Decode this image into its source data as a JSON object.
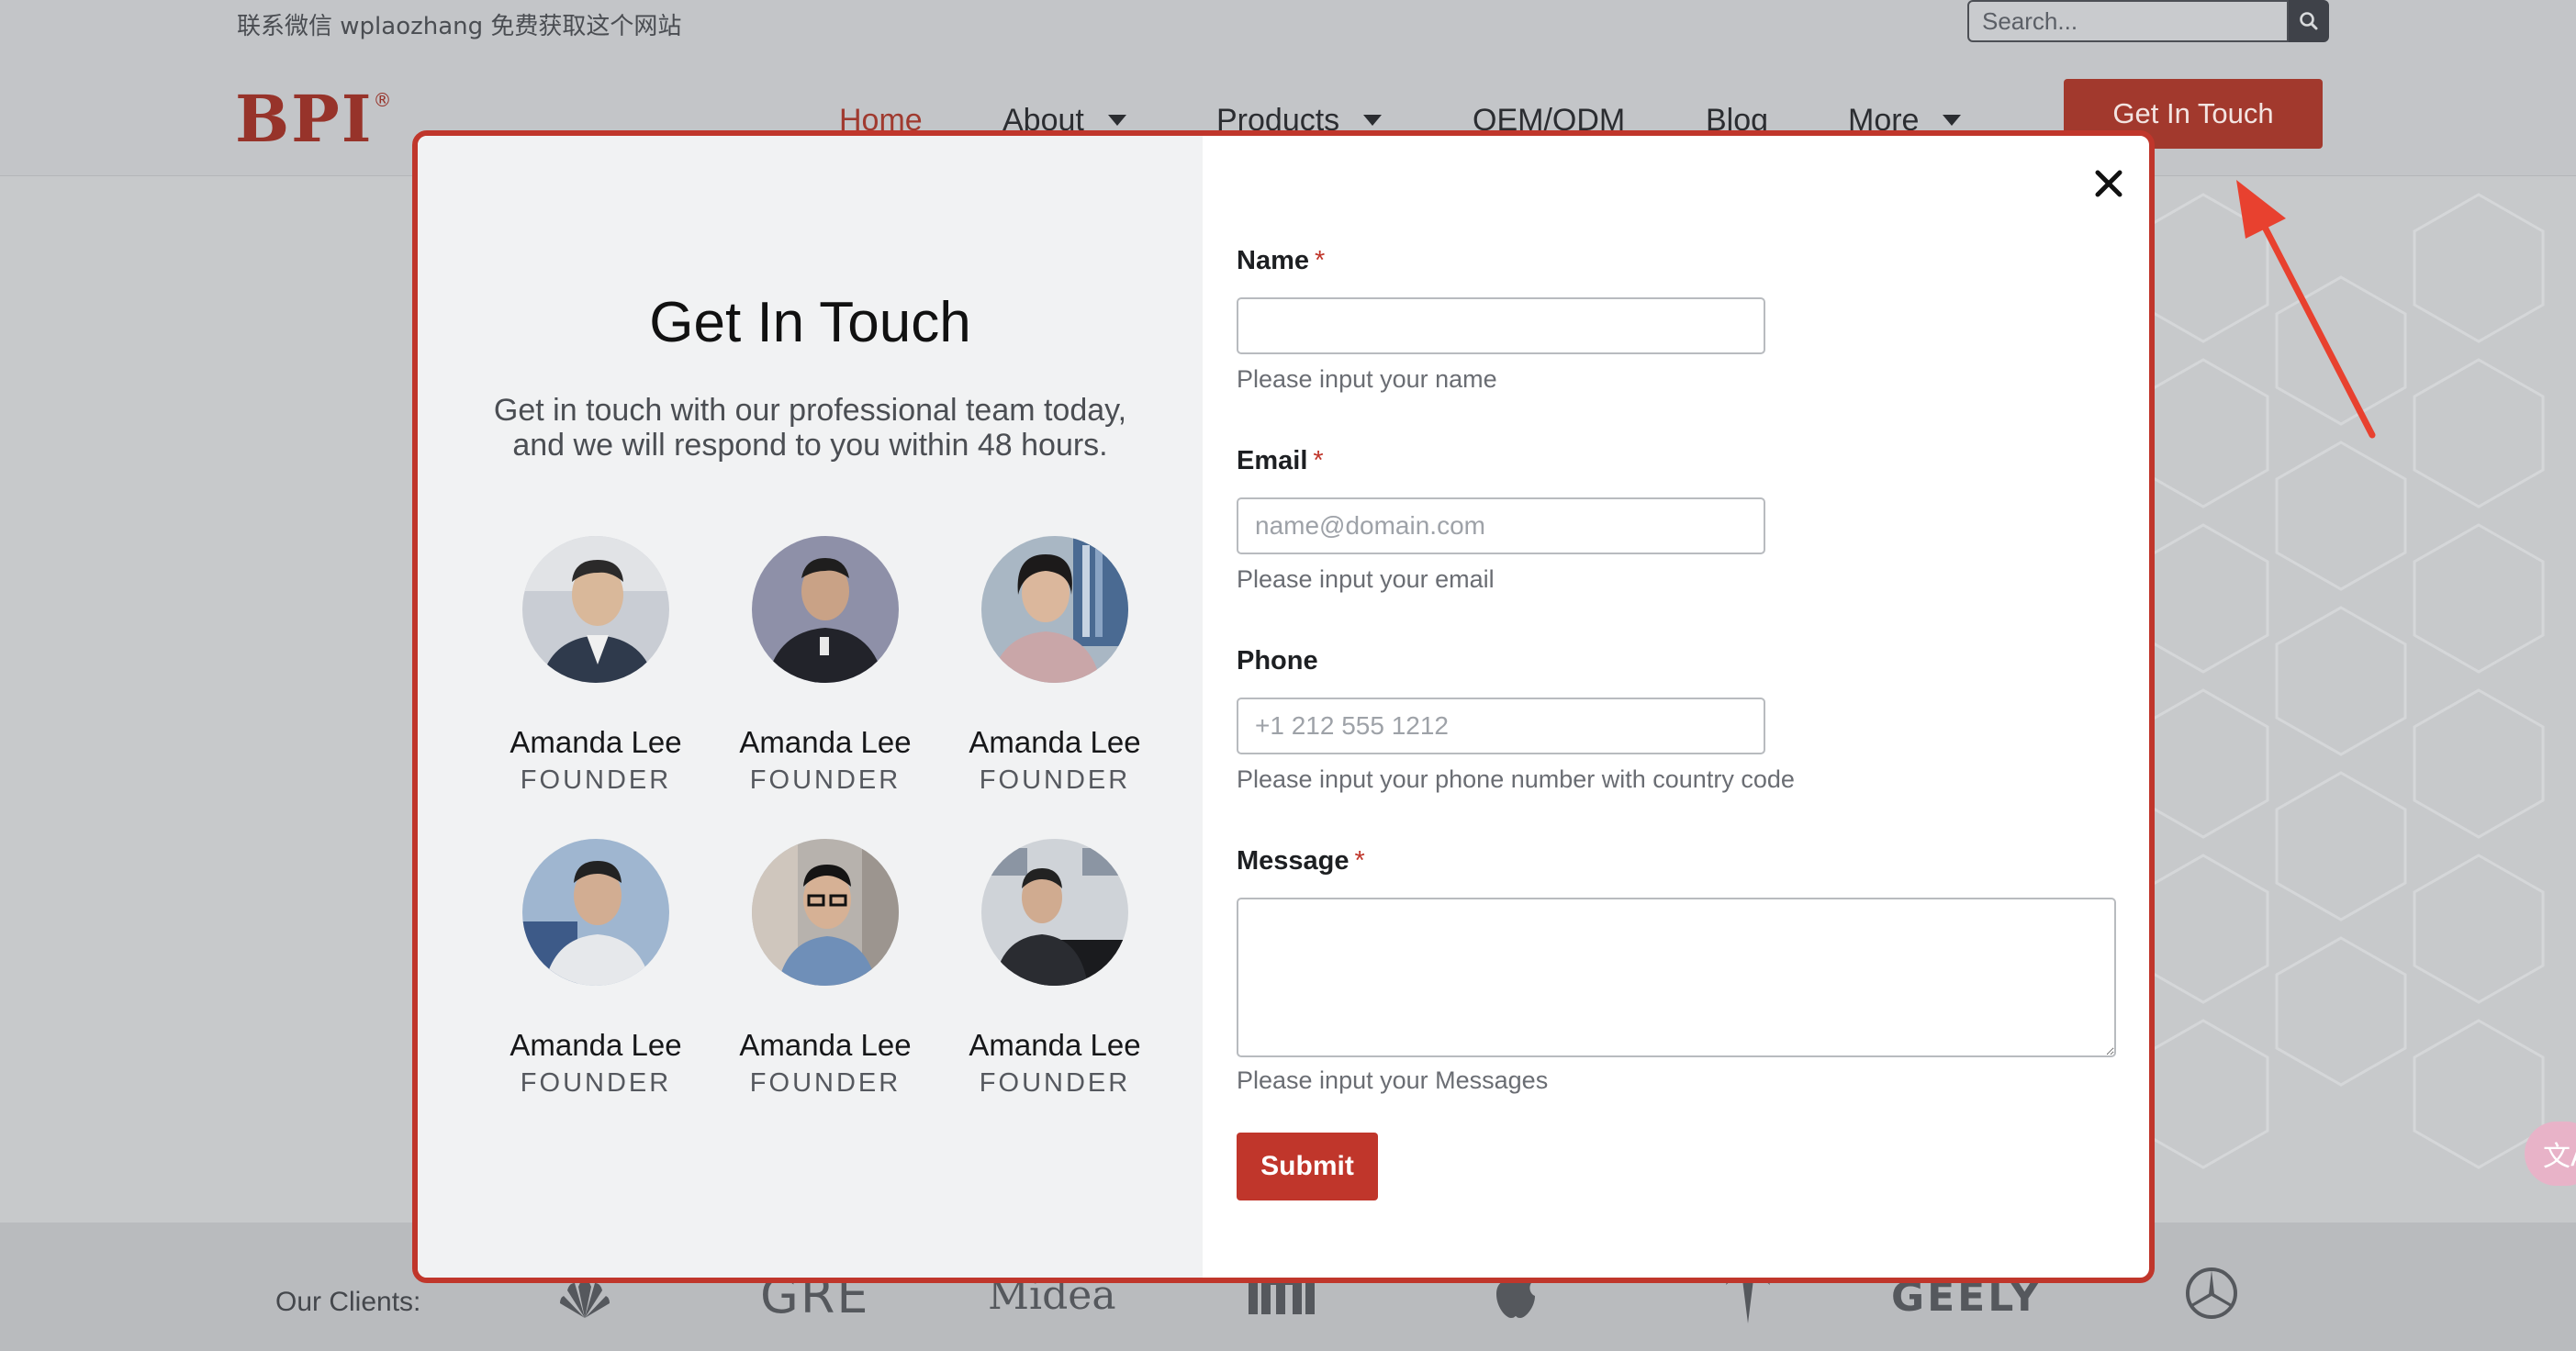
{
  "topbar": {
    "wechat_text": "联系微信 wplaozhang 免费获取这个网站",
    "search_placeholder": "Search..."
  },
  "header": {
    "logo_text": "BPI",
    "logo_mark": "®",
    "nav": [
      {
        "label": "Home",
        "active": true,
        "has_dropdown": false
      },
      {
        "label": "About",
        "active": false,
        "has_dropdown": true
      },
      {
        "label": "Products",
        "active": false,
        "has_dropdown": true
      },
      {
        "label": "OEM/ODM",
        "active": false,
        "has_dropdown": false
      },
      {
        "label": "Blog",
        "active": false,
        "has_dropdown": false
      },
      {
        "label": "More",
        "active": false,
        "has_dropdown": true
      }
    ],
    "cta_label": "Get In Touch"
  },
  "modal": {
    "title": "Get In Touch",
    "subtitle": "Get in touch with our professional team today, and we will respond to you within 48 hours.",
    "team": [
      {
        "name": "Amanda Lee",
        "role": "FOUNDER"
      },
      {
        "name": "Amanda Lee",
        "role": "FOUNDER"
      },
      {
        "name": "Amanda Lee",
        "role": "FOUNDER"
      },
      {
        "name": "Amanda Lee",
        "role": "FOUNDER"
      },
      {
        "name": "Amanda Lee",
        "role": "FOUNDER"
      },
      {
        "name": "Amanda Lee",
        "role": "FOUNDER"
      }
    ],
    "form": {
      "name": {
        "label": "Name",
        "required_mark": "*",
        "value": "",
        "placeholder": "",
        "help": "Please input your name"
      },
      "email": {
        "label": "Email",
        "required_mark": "*",
        "value": "",
        "placeholder": "name@domain.com",
        "help": "Please input your email"
      },
      "phone": {
        "label": "Phone",
        "value": "",
        "placeholder": "+1 212 555 1212",
        "help": "Please input your phone number with country code"
      },
      "message": {
        "label": "Message",
        "required_mark": "*",
        "value": "",
        "help": "Please input your Messages"
      },
      "submit_label": "Submit"
    }
  },
  "clients": {
    "label": "Our Clients:",
    "logos": [
      "GRE",
      "Midea",
      "GEELY"
    ]
  },
  "translate_bubble": "文A",
  "colors": {
    "brand": "#c0362b",
    "overlay": "#c3c5c8",
    "modal_left_bg": "#f1f2f3"
  }
}
